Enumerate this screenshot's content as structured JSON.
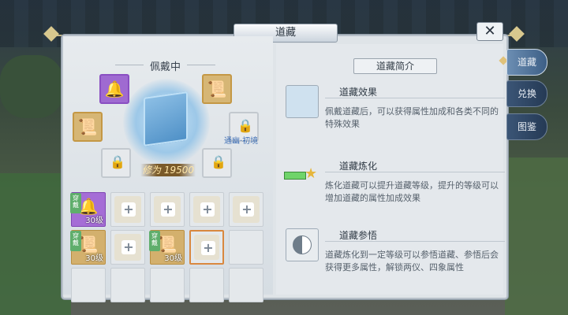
{
  "window": {
    "title": "道藏",
    "close_label": "✕"
  },
  "left": {
    "wearing_label": "佩戴中",
    "cultivation_prefix": "修为",
    "cultivation_value": "19500",
    "locked_slot_hint": "通幽·初境"
  },
  "grid": {
    "equipped_badge": "穿戴",
    "level_label": "30级"
  },
  "right": {
    "header": "道藏简介",
    "sections": [
      {
        "title": "道藏效果",
        "text": "佩戴道藏后，可以获得属性加成和各类不同的特殊效果"
      },
      {
        "title": "道藏炼化",
        "text": "炼化道藏可以提升道藏等级，提升的等级可以增加道藏的属性加成效果"
      },
      {
        "title": "道藏参悟",
        "text": "道藏炼化到一定等级可以参悟道藏、参悟后会获得更多属性，解锁两仪、四象属性"
      }
    ]
  },
  "tabs": [
    "道藏",
    "兑换",
    "图鉴"
  ],
  "colors": {
    "active_tab": "#5479a0",
    "idle_tab": "#2f4766",
    "purple_quality": "#a56dd6",
    "gold_quality": "#d3b06d",
    "cultivation_text": "#ffe7a8"
  }
}
